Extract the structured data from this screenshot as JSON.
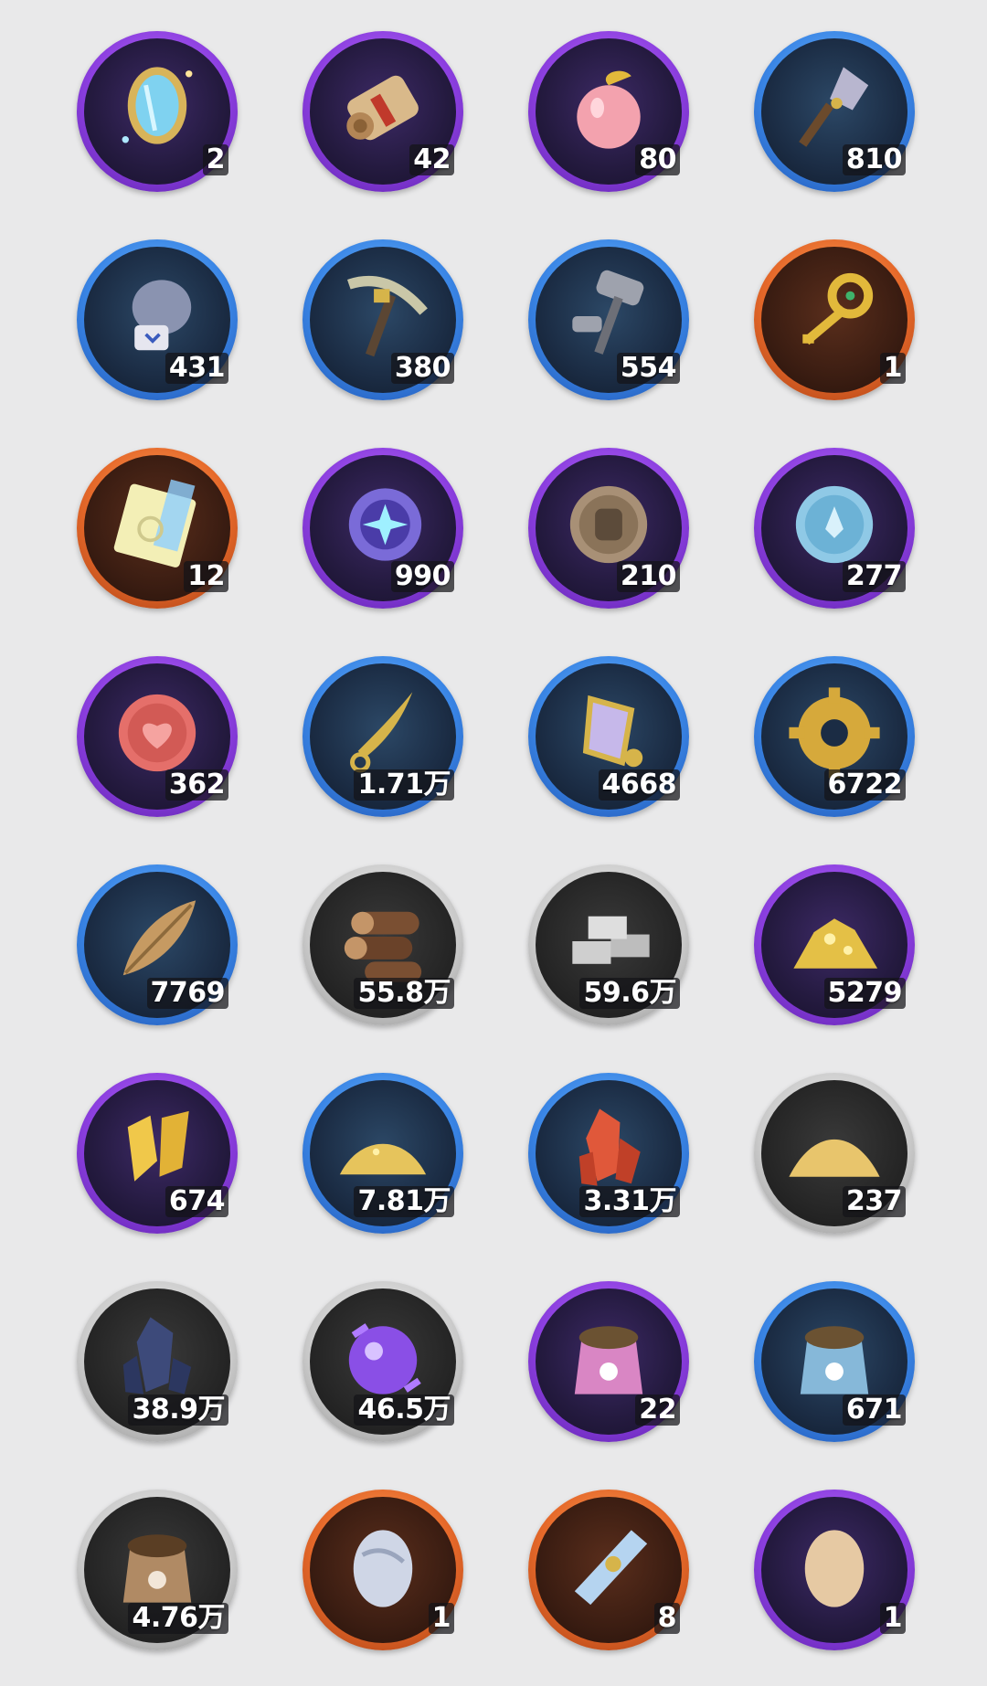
{
  "inventory": {
    "items": [
      {
        "icon": "magic-mirror-icon",
        "rarity": "purple",
        "count": "2"
      },
      {
        "icon": "scroll-icon",
        "rarity": "purple",
        "count": "42"
      },
      {
        "icon": "peach-icon",
        "rarity": "purple",
        "count": "80"
      },
      {
        "icon": "shovel-icon",
        "rarity": "blue",
        "count": "810"
      },
      {
        "icon": "boxing-glove-icon",
        "rarity": "blue",
        "count": "431"
      },
      {
        "icon": "pickaxe-icon",
        "rarity": "blue",
        "count": "380"
      },
      {
        "icon": "hammer-icon",
        "rarity": "blue",
        "count": "554"
      },
      {
        "icon": "golden-key-icon",
        "rarity": "orange",
        "count": "1"
      },
      {
        "icon": "rainbow-ticket-icon",
        "rarity": "orange",
        "count": "12"
      },
      {
        "icon": "star-coin-icon",
        "rarity": "purple",
        "count": "990"
      },
      {
        "icon": "fist-coin-icon",
        "rarity": "purple",
        "count": "210"
      },
      {
        "icon": "crest-coin-icon",
        "rarity": "purple",
        "count": "277"
      },
      {
        "icon": "heart-coin-icon",
        "rarity": "purple",
        "count": "362"
      },
      {
        "icon": "golden-blade-icon",
        "rarity": "blue",
        "count": "1.71万"
      },
      {
        "icon": "scale-pendant-icon",
        "rarity": "blue",
        "count": "4668"
      },
      {
        "icon": "gear-icon",
        "rarity": "blue",
        "count": "6722"
      },
      {
        "icon": "leaf-icon",
        "rarity": "blue",
        "count": "7769"
      },
      {
        "icon": "wood-logs-icon",
        "rarity": "gray",
        "count": "55.8万"
      },
      {
        "icon": "stone-bricks-icon",
        "rarity": "gray",
        "count": "59.6万"
      },
      {
        "icon": "gold-pile-icon",
        "rarity": "purple",
        "count": "5279"
      },
      {
        "icon": "gold-crystal-icon",
        "rarity": "purple",
        "count": "674"
      },
      {
        "icon": "gold-dust-icon",
        "rarity": "blue",
        "count": "7.81万"
      },
      {
        "icon": "red-crystal-icon",
        "rarity": "blue",
        "count": "3.31万"
      },
      {
        "icon": "sand-pile-icon",
        "rarity": "gray",
        "count": "237"
      },
      {
        "icon": "dark-crystal-icon",
        "rarity": "gray",
        "count": "38.9万"
      },
      {
        "icon": "purple-orb-icon",
        "rarity": "gray",
        "count": "46.5万"
      },
      {
        "icon": "pink-pet-food-bag-icon",
        "rarity": "purple",
        "count": "22"
      },
      {
        "icon": "blue-pet-food-bag-icon",
        "rarity": "blue",
        "count": "671"
      },
      {
        "icon": "brown-pet-food-bag-icon",
        "rarity": "gray",
        "count": "4.76万"
      },
      {
        "icon": "silver-egg-icon",
        "rarity": "orange",
        "count": "1"
      },
      {
        "icon": "silk-bundle-icon",
        "rarity": "orange",
        "count": "8"
      },
      {
        "icon": "brown-egg-icon",
        "rarity": "purple",
        "count": "1"
      }
    ]
  }
}
